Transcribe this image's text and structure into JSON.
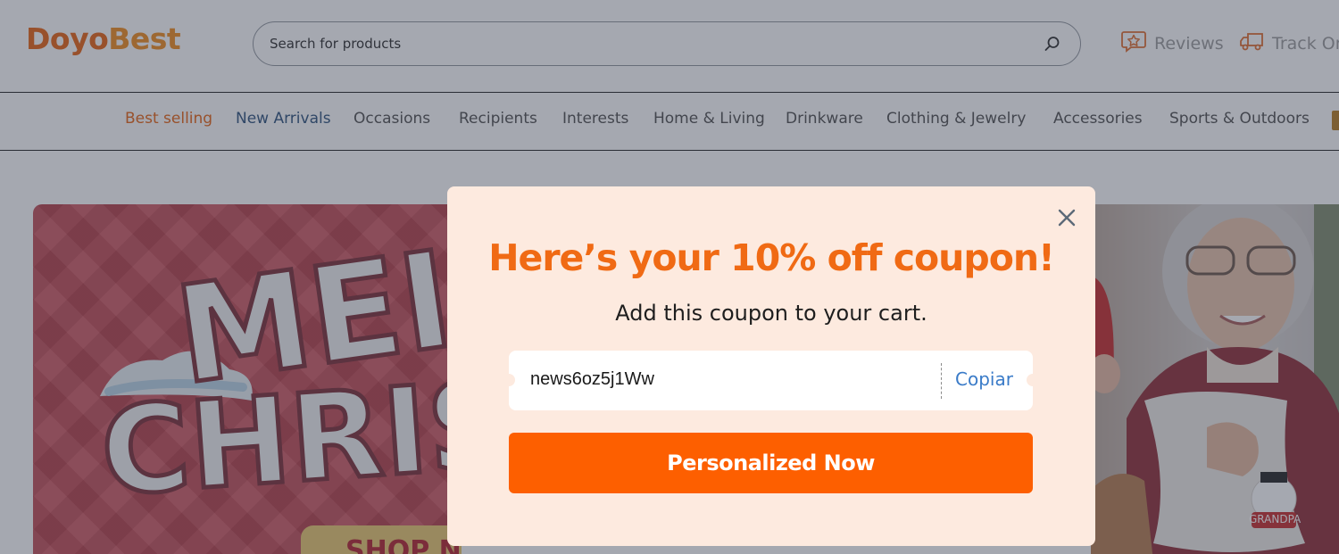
{
  "brand": {
    "logo_part1": "Doyo",
    "logo_part2": "Best"
  },
  "search": {
    "placeholder": "Search for products",
    "icon": "search-icon"
  },
  "header_links": [
    {
      "label": "Reviews",
      "icon": "review-star-icon"
    },
    {
      "label": "Track Or",
      "icon": "delivery-truck-icon"
    }
  ],
  "nav": {
    "items": [
      "Best selling",
      "New Arrivals",
      "Occasions",
      "Recipients",
      "Interests",
      "Home & Living",
      "Drinkware",
      "Clothing & Jewelry",
      "Accessories",
      "Sports & Outdoors"
    ],
    "active_index": 0
  },
  "banner": {
    "left_text_line1": "MEI",
    "left_text_line2": "CHRIS",
    "left_button_text": "SHOP NOW",
    "right_pillow_text": "GRANDPA"
  },
  "modal": {
    "title": "Here’s your 10% off coupon!",
    "subtitle": "Add this coupon to your cart.",
    "coupon_code": "news6oz5j1Ww",
    "copy_label": "Copiar",
    "cta_label": "Personalized Now",
    "close_icon": "close-icon"
  },
  "colors": {
    "accent": "#fd5f00",
    "title": "#f06a14",
    "modal_bg": "#fdeadf",
    "link_blue": "#3a7bc8",
    "logo_orange": "#e8620f"
  }
}
